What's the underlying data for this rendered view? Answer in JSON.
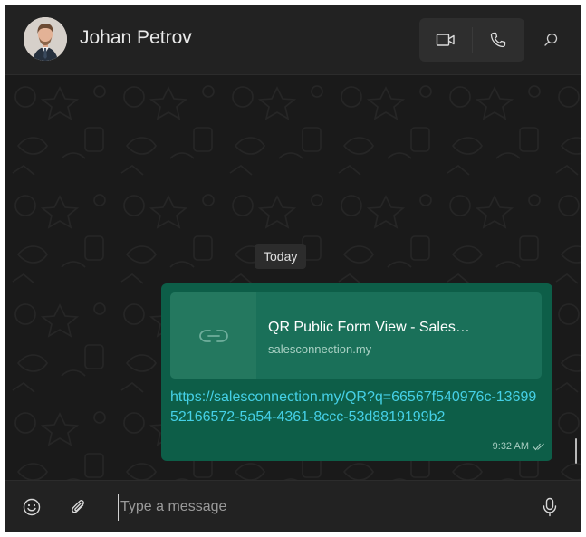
{
  "header": {
    "contact_name": "Johan Petrov",
    "avatar_icon": "user-avatar",
    "video_call_icon": "video-camera-icon",
    "voice_call_icon": "phone-icon",
    "search_icon": "search-icon"
  },
  "chat": {
    "date_separator": "Today",
    "messages": [
      {
        "direction": "outgoing",
        "link_preview": {
          "thumbnail_icon": "link-icon",
          "title": "QR Public Form View - Sales…",
          "domain": "salesconnection.my"
        },
        "text": "https://salesconnection.my/QR?q=66567f540976c-1369952166572-5a54-4361-8ccc-53d8819199b2",
        "time": "9:32 AM",
        "status_icon": "double-check-icon"
      }
    ]
  },
  "composer": {
    "placeholder": "Type a message",
    "emoji_icon": "emoji-icon",
    "attach_icon": "paperclip-icon",
    "mic_icon": "microphone-icon"
  },
  "colors": {
    "header_bg": "#222222",
    "chat_bg": "#1a1a1a",
    "outgoing_bubble": "#0d5e48",
    "link_color": "#45d0e6"
  }
}
